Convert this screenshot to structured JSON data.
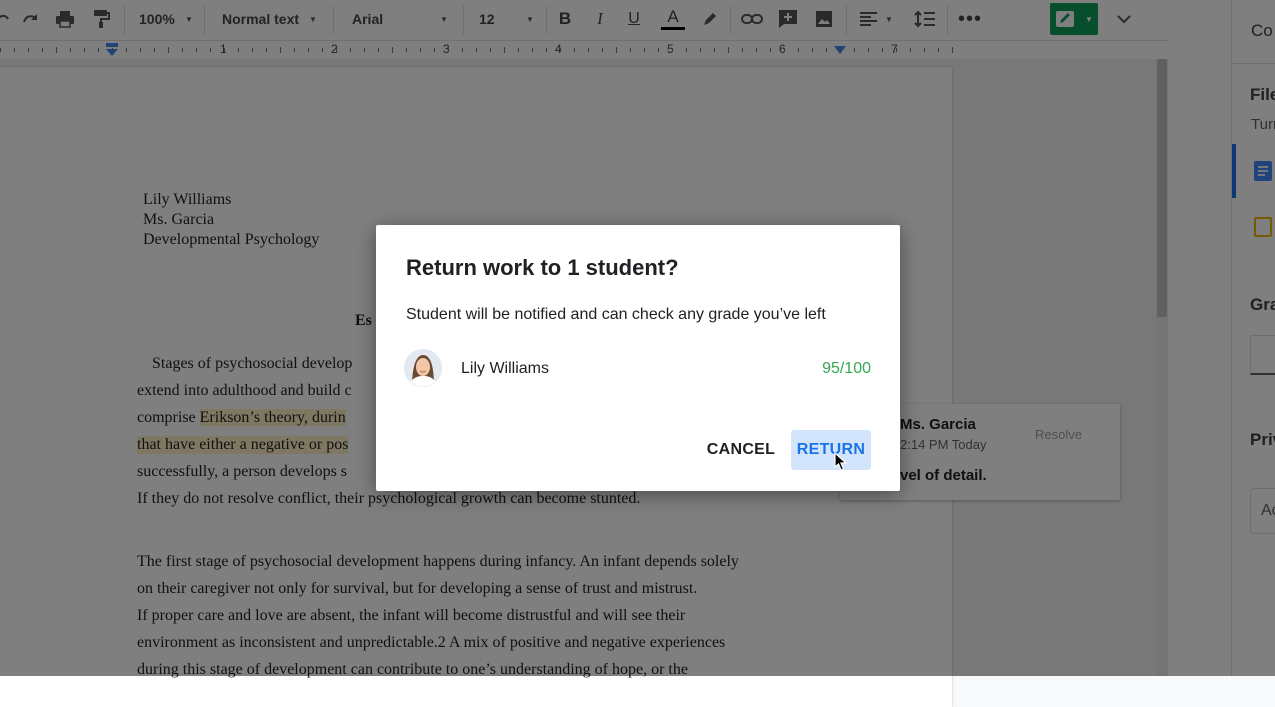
{
  "toolbar": {
    "zoom": "100%",
    "style": "Normal text",
    "font": "Arial",
    "size": "12"
  },
  "ruler": {
    "numbers": [
      "1",
      "2",
      "3",
      "4",
      "5",
      "6",
      "7"
    ]
  },
  "document": {
    "header_lines": [
      "Lily Williams",
      "Ms. Garcia",
      "Developmental Psychology"
    ],
    "title_fragment": "Es",
    "para1": {
      "line1": "Stages of psychosocial develop",
      "line2": "extend into adulthood and build c",
      "line3_plain": "comprise ",
      "line3_hl": "Erikson’s theory, durin",
      "line4_hl": "that have either a negative or pos",
      "line5": "successfully, a person develops  s",
      "line6": "If they do not resolve conflict, their psychological growth can become stunted."
    },
    "para2": [
      "The first stage of psychosocial development happens during infancy. An infant depends solely",
      "on their caregiver not only for survival, but for developing a sense of trust and mistrust.",
      "If proper care and love are absent, the infant will become distrustful and will see their",
      "environment as inconsistent and unpredictable.2 A mix of positive and negative experiences",
      "during this stage of development can contribute to one’s understanding of hope, or the"
    ]
  },
  "comment": {
    "author": "Ms. Garcia",
    "time": "2:14 PM Today",
    "resolve": "Resolve",
    "text": "vel of detail."
  },
  "right_panel": {
    "heading": "Co",
    "files": "File",
    "turn": "Turn",
    "grade": "Gra",
    "private": "Priv",
    "add": "Ac"
  },
  "dialog": {
    "title": "Return work to 1 student?",
    "description": "Student will be notified and can check any grade you’ve left",
    "student_name": "Lily Williams",
    "grade": "95/100",
    "cancel_label": "CANCEL",
    "return_label": "RETURN"
  },
  "colors": {
    "accent_blue": "#1a73e8",
    "grade_green": "#34a853",
    "pen_green": "#0f9d58",
    "highlight": "#fcefc5"
  }
}
